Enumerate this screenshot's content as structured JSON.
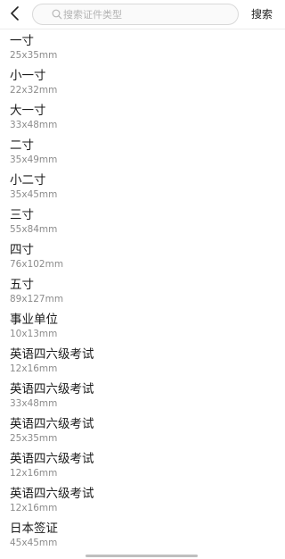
{
  "header": {
    "search_placeholder": "搜索证件类型",
    "search_button_label": "搜索"
  },
  "items": [
    {
      "name": "一寸",
      "size": "25x35mm"
    },
    {
      "name": "小一寸",
      "size": "22x32mm"
    },
    {
      "name": "大一寸",
      "size": "33x48mm"
    },
    {
      "name": "二寸",
      "size": "35x49mm"
    },
    {
      "name": "小二寸",
      "size": "35x45mm"
    },
    {
      "name": "三寸",
      "size": "55x84mm"
    },
    {
      "name": "四寸",
      "size": "76x102mm"
    },
    {
      "name": "五寸",
      "size": "89x127mm"
    },
    {
      "name": "事业单位",
      "size": "10x13mm"
    },
    {
      "name": "英语四六级考试",
      "size": "12x16mm"
    },
    {
      "name": "英语四六级考试",
      "size": "33x48mm"
    },
    {
      "name": "英语四六级考试",
      "size": "25x35mm"
    },
    {
      "name": "英语四六级考试",
      "size": "12x16mm"
    },
    {
      "name": "英语四六级考试",
      "size": "12x16mm"
    },
    {
      "name": "日本签证",
      "size": "45x45mm"
    }
  ],
  "icons": {
    "back": "chevron-left-icon",
    "search": "search-icon"
  }
}
